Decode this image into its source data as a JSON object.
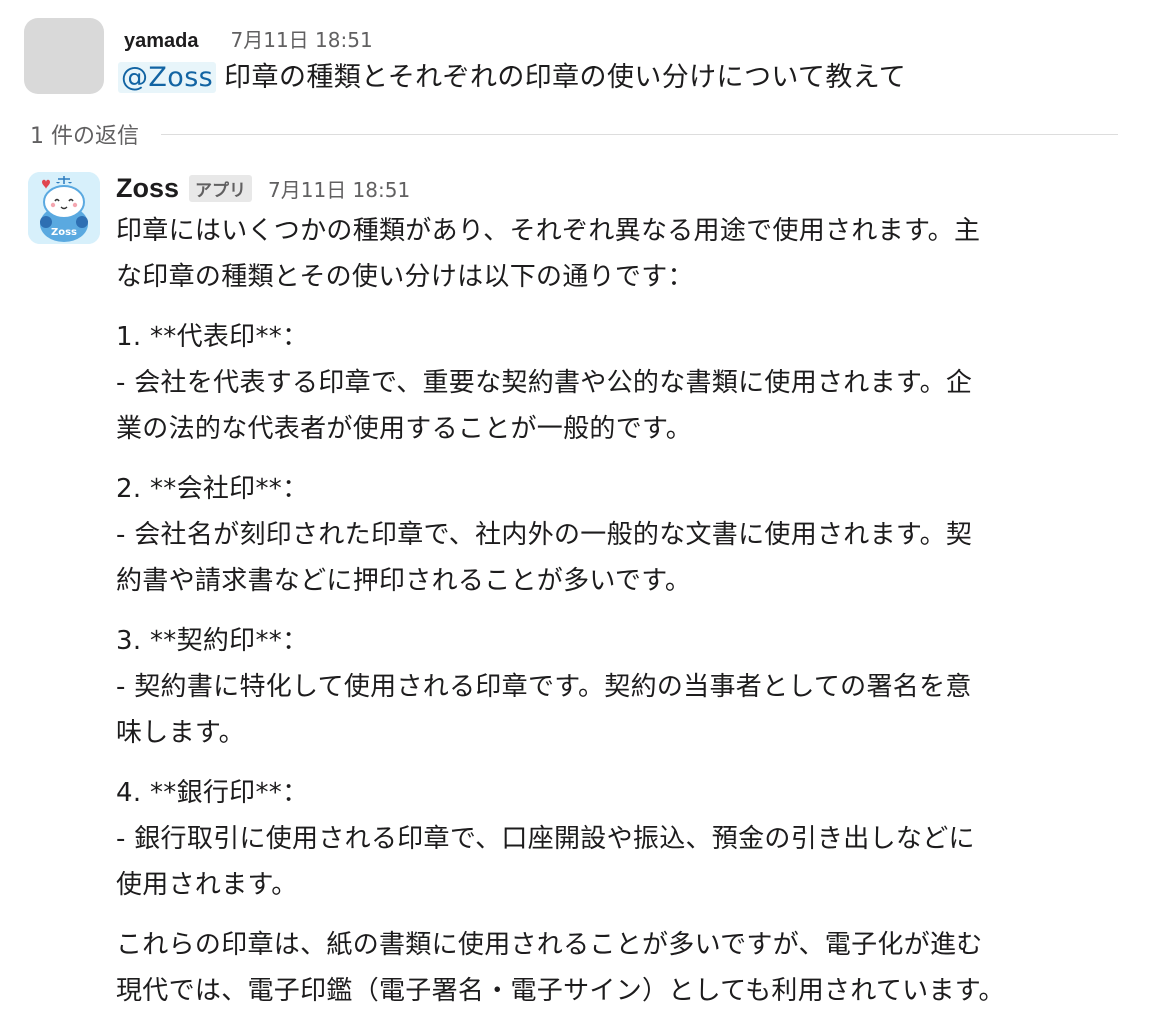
{
  "parent": {
    "username": "yamada",
    "timestamp": "7月11日 18:51",
    "mention": "@Zoss",
    "text": "印章の種類とそれぞれの印章の使い分けについて教えて"
  },
  "thread": {
    "reply_count": "1 件の返信"
  },
  "reply": {
    "bot_name": "Zoss",
    "badge": "アプリ",
    "timestamp": "7月11日 18:51",
    "lines": [
      "印章にはいくつかの種類があり、それぞれ異なる用途で使用されます。主",
      "な印章の種類とその使い分けは以下の通りです：",
      "1. **代表印**：",
      "  - 会社を代表する印章で、重要な契約書や公的な書類に使用されます。企",
      "業の法的な代表者が使用することが一般的です。",
      "2. **会社印**：",
      "  - 会社名が刻印された印章で、社内外の一般的な文書に使用されます。契",
      "約書や請求書などに押印されることが多いです。",
      "3. **契約印**：",
      "  - 契約書に特化して使用される印章です。契約の当事者としての署名を意",
      "味します。",
      "4. **銀行印**：",
      "  - 銀行取引に使用される印章で、口座開設や振込、預金の引き出しなどに",
      "使用されます。",
      "これらの印章は、紙の書類に使用されることが多いですが、電子化が進む",
      "現代では、電子印鑑（電子署名・電子サイン）としても利用されています。"
    ]
  },
  "colors": {
    "mention_bg": "#e8f5fa",
    "mention_text": "#1264a3",
    "avatar_bg": "#d7f0fb"
  }
}
